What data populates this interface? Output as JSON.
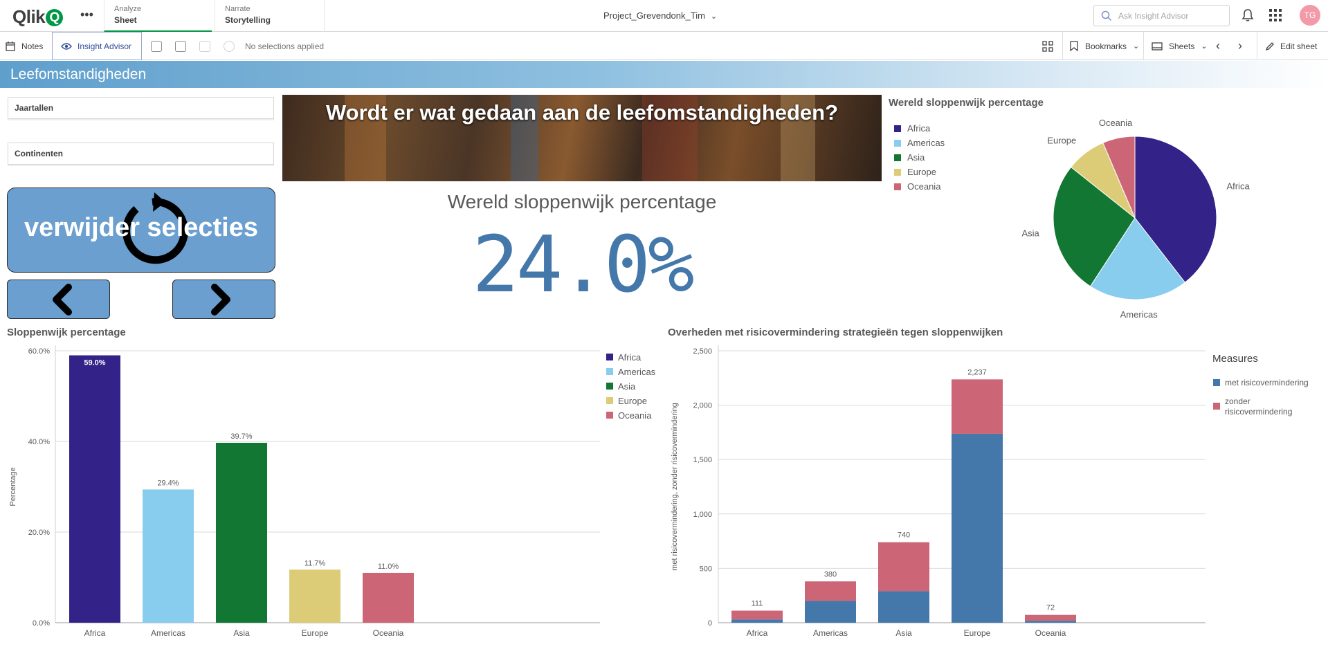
{
  "app": {
    "logo_text": "Qlik",
    "logo_q": "Q",
    "tabs": [
      {
        "small": "Analyze",
        "big": "Sheet"
      },
      {
        "small": "Narrate",
        "big": "Storytelling"
      }
    ],
    "title": "Project_Grevendonk_Tim",
    "search_placeholder": "Ask Insight Advisor",
    "avatar_initials": "TG"
  },
  "toolbar": {
    "notes": "Notes",
    "insight_advisor": "Insight Advisor",
    "no_selections": "No selections applied",
    "bookmarks": "Bookmarks",
    "sheets": "Sheets",
    "edit_sheet": "Edit sheet"
  },
  "sheet": {
    "title": "Leefomstandigheden",
    "filters": [
      "Jaartallen",
      "Continenten"
    ],
    "clear_button": "verwijder selecties",
    "banner_text": "Wordt er wat gedaan aan de leefomstandigheden?",
    "kpi": {
      "title": "Wereld sloppenwijk percentage",
      "value": "24.0%"
    }
  },
  "colors": {
    "Africa": "#332288",
    "Americas": "#88ccee",
    "Asia": "#117733",
    "Europe": "#ddcc77",
    "Oceania": "#cc6677",
    "met": "#4477aa",
    "zonder": "#cc6677",
    "accent": "#009845"
  },
  "chart_data": [
    {
      "type": "pie",
      "title": "Wereld sloppenwijk percentage",
      "categories": [
        "Africa",
        "Americas",
        "Asia",
        "Europe",
        "Oceania"
      ],
      "values": [
        39.5,
        19.7,
        26.5,
        7.9,
        6.4
      ],
      "legend": "left"
    },
    {
      "type": "bar",
      "title": "Sloppenwijk percentage",
      "ylabel": "Percentage",
      "categories": [
        "Africa",
        "Americas",
        "Asia",
        "Europe",
        "Oceania"
      ],
      "values": [
        59.0,
        29.4,
        39.7,
        11.7,
        11.0
      ],
      "value_labels": [
        "59.0%",
        "29.4%",
        "39.7%",
        "11.7%",
        "11.0%"
      ],
      "ylim": [
        0,
        60
      ],
      "yticks": [
        "0.0%",
        "20.0%",
        "40.0%",
        "60.0%"
      ],
      "legend": "right"
    },
    {
      "type": "bar",
      "stacked": true,
      "title": "Overheden met risicovermindering strategieën tegen sloppenwijken",
      "ylabel": "met risicovermindering, zonder risicovermindering",
      "legend_title": "Measures",
      "categories": [
        "Africa",
        "Americas",
        "Asia",
        "Europe",
        "Oceania"
      ],
      "series": [
        {
          "name": "met risicovermindering",
          "values": [
            30,
            200,
            290,
            1737,
            18
          ]
        },
        {
          "name": "zonder risicovermindering",
          "values": [
            81,
            180,
            450,
            500,
            54
          ]
        }
      ],
      "totals": [
        "111",
        "380",
        "740",
        "2,237",
        "72"
      ],
      "ylim": [
        0,
        2500
      ],
      "yticks": [
        "0",
        "500",
        "1,000",
        "1,500",
        "2,000",
        "2,500"
      ],
      "legend": "right"
    }
  ]
}
